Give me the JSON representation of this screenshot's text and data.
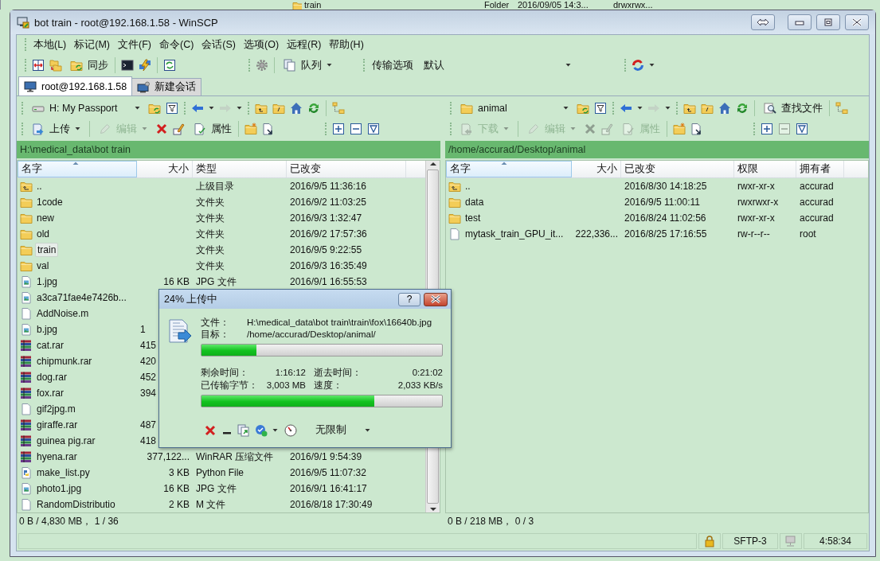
{
  "background_window": {
    "name": "train",
    "type": "Folder",
    "changed": "2016/09/05 14:3...",
    "rights": "drwxrwx..."
  },
  "window": {
    "title": "bot train - root@192.168.1.58 - WinSCP"
  },
  "menu": [
    "本地(L)",
    "标记(M)",
    "文件(F)",
    "命令(C)",
    "会话(S)",
    "选项(O)",
    "远程(R)",
    "帮助(H)"
  ],
  "toolbar": {
    "sync": "同步",
    "queue": "队列",
    "transfer_options": "传输选项",
    "transfer_preset": "默认"
  },
  "session_tabs": [
    {
      "label": "root@192.168.1.58",
      "selected": true
    },
    {
      "label": "新建会话",
      "selected": false
    }
  ],
  "left_panel": {
    "location": {
      "label": "H: My Passport",
      "kind": "drive"
    },
    "transfer": {
      "label": "上传",
      "kind": "upload",
      "disabled": false
    },
    "edit": {
      "label": "编辑",
      "disabled": true
    },
    "delete": {
      "disabled": false
    },
    "rename": {
      "disabled": false
    },
    "properties": {
      "label": "属性",
      "disabled": false
    },
    "unselect": {
      "disabled": false
    },
    "path": "H:\\medical_data\\bot train",
    "columns": [
      {
        "label": "名字",
        "sorted": true
      },
      {
        "label": "大小",
        "sorted": false
      },
      {
        "label": "类型",
        "sorted": false
      },
      {
        "label": "已改变",
        "sorted": false
      }
    ],
    "rows": [
      {
        "kind": "parent",
        "name": "..",
        "type": "上级目录",
        "changed": "2016/9/5  11:36:16",
        "selected": false
      },
      {
        "kind": "folder",
        "name": "1code",
        "type": "文件夹",
        "changed": "2016/9/2  11:03:25",
        "selected": false
      },
      {
        "kind": "folder",
        "name": "new",
        "type": "文件夹",
        "changed": "2016/9/3  1:32:47",
        "selected": false
      },
      {
        "kind": "folder",
        "name": "old",
        "type": "文件夹",
        "changed": "2016/9/2  17:57:36",
        "selected": false
      },
      {
        "kind": "folder",
        "name": "train",
        "type": "文件夹",
        "changed": "2016/9/5  9:22:55",
        "selected": true
      },
      {
        "kind": "folder",
        "name": "val",
        "type": "文件夹",
        "changed": "2016/9/3  16:35:49",
        "selected": false
      },
      {
        "kind": "image",
        "name": "1.jpg",
        "size": "16 KB",
        "type": "JPG 文件",
        "changed": "2016/9/1  16:55:53",
        "selected": false
      },
      {
        "kind": "image",
        "name": "a3ca71fae4e7426b...",
        "selected": false
      },
      {
        "kind": "file",
        "name": "AddNoise.m",
        "selected": false
      },
      {
        "kind": "image",
        "name": "b.jpg",
        "size_cut": "1",
        "selected": false
      },
      {
        "kind": "archive",
        "name": "cat.rar",
        "size_cut": "415",
        "selected": false
      },
      {
        "kind": "archive",
        "name": "chipmunk.rar",
        "size_cut": "420",
        "selected": false
      },
      {
        "kind": "archive",
        "name": "dog.rar",
        "size_cut": "452",
        "selected": false
      },
      {
        "kind": "archive",
        "name": "fox.rar",
        "size_cut": "394",
        "selected": false
      },
      {
        "kind": "file",
        "name": "gif2jpg.m",
        "selected": false
      },
      {
        "kind": "archive",
        "name": "giraffe.rar",
        "size_cut": "487",
        "selected": false
      },
      {
        "kind": "archive",
        "name": "guinea pig.rar",
        "size_cut": "418",
        "selected": false
      },
      {
        "kind": "archive",
        "name": "hyena.rar",
        "size": "377,122...",
        "type": "WinRAR 压缩文件",
        "changed": "2016/9/1  9:54:39",
        "selected": false
      },
      {
        "kind": "python",
        "name": "make_list.py",
        "size": "3 KB",
        "type": "Python File",
        "changed": "2016/9/5  11:07:32",
        "selected": false
      },
      {
        "kind": "image",
        "name": "photo1.jpg",
        "size": "16 KB",
        "type": "JPG 文件",
        "changed": "2016/9/1  16:41:17",
        "selected": false
      },
      {
        "kind": "file",
        "name": "RandomDistributio",
        "size": "2 KB",
        "type": "M 文件",
        "changed": "2016/8/18  17:30:49",
        "selected": false
      }
    ],
    "status": "0 B / 4,830 MB， 1 / 36"
  },
  "right_panel": {
    "location": {
      "label": "animal",
      "kind": "folder"
    },
    "find": "查找文件",
    "transfer": {
      "label": "下载",
      "kind": "download",
      "disabled": true
    },
    "edit": {
      "label": "编辑",
      "disabled": true
    },
    "delete": {
      "disabled": true
    },
    "rename": {
      "disabled": true
    },
    "properties": {
      "label": "属性",
      "disabled": true
    },
    "unselect": {
      "disabled": true
    },
    "path": "/home/accurad/Desktop/animal",
    "columns": [
      {
        "label": "名字",
        "sorted": true
      },
      {
        "label": "大小",
        "sorted": false
      },
      {
        "label": "已改变",
        "sorted": false
      },
      {
        "label": "权限",
        "sorted": false
      },
      {
        "label": "拥有者",
        "sorted": false
      }
    ],
    "rows": [
      {
        "kind": "parent",
        "name": "..",
        "changed": "2016/8/30 14:18:25",
        "rights": "rwxr-xr-x",
        "owner": "accurad",
        "selected": false
      },
      {
        "kind": "folder",
        "name": "data",
        "changed": "2016/9/5 11:00:11",
        "rights": "rwxrwxr-x",
        "owner": "accurad",
        "selected": false
      },
      {
        "kind": "folder",
        "name": "test",
        "changed": "2016/8/24 11:02:56",
        "rights": "rwxr-xr-x",
        "owner": "accurad",
        "selected": false
      },
      {
        "kind": "file",
        "name": "mytask_train_GPU_it...",
        "size": "222,336...",
        "changed": "2016/8/25 17:16:55",
        "rights": "rw-r--r--",
        "owner": "root",
        "selected": false
      }
    ],
    "status": "0 B / 218 MB， 0 / 3"
  },
  "dialog": {
    "title": "24% 上传中",
    "help": "?",
    "file_label": "文件：",
    "file": "H:\\medical_data\\bot train\\train\\fox\\16640b.jpg",
    "target_label": "目标：",
    "target": "/home/accurad/Desktop/animal/",
    "file_progress": {
      "level": 0.23
    },
    "time_left_label": "剩余时间：",
    "time_left": "1:16:12",
    "elapsed_label": "逝去时间：",
    "elapsed": "0:21:02",
    "bytes_label": "已传输字节：",
    "bytes": "3,003 MB",
    "speed_label": "速度：",
    "speed": "2,033 KB/s",
    "total_progress": {
      "level": 0.72
    },
    "speed_limit": "无限制"
  },
  "status_bar": {
    "protocol": "SFTP-3",
    "time": "4:58:34"
  }
}
